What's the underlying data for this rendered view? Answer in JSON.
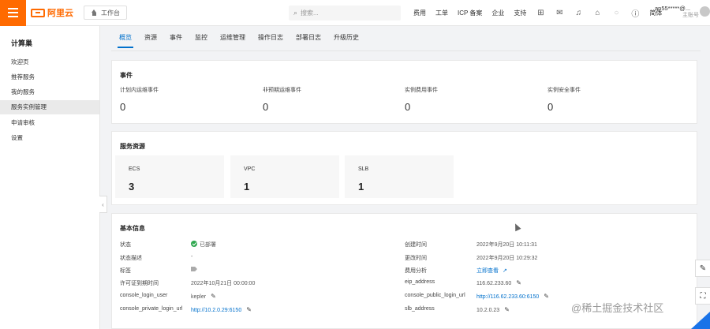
{
  "header": {
    "logo_text": "阿里云",
    "workbench_label": "工作台",
    "search_placeholder": "搜索...",
    "links": [
      "费用",
      "工单",
      "ICP 备案",
      "企业",
      "支持"
    ],
    "lang": "简体",
    "user_name": "ap55*****@...",
    "user_sub": "主账号"
  },
  "sidebar": {
    "title": "计算巢",
    "items": [
      "欢迎页",
      "推荐服务",
      "我的服务",
      "服务实例管理",
      "申请审核",
      "设置"
    ],
    "active_index": 3
  },
  "tabs": {
    "items": [
      "概览",
      "资源",
      "事件",
      "监控",
      "运维管理",
      "操作日志",
      "部署日志",
      "升级历史"
    ],
    "active_index": 0
  },
  "events": {
    "title": "事件",
    "items": [
      {
        "label": "计划内运维事件",
        "value": "0"
      },
      {
        "label": "非预期运维事件",
        "value": "0"
      },
      {
        "label": "实例费用事件",
        "value": "0"
      },
      {
        "label": "实例安全事件",
        "value": "0"
      }
    ]
  },
  "resources": {
    "title": "服务资源",
    "items": [
      {
        "label": "ECS",
        "value": "3"
      },
      {
        "label": "VPC",
        "value": "1"
      },
      {
        "label": "SLB",
        "value": "1"
      }
    ]
  },
  "basic_info": {
    "title": "基本信息",
    "left": [
      {
        "label": "状态",
        "value": "已部署"
      },
      {
        "label": "状态描述",
        "value": "-"
      },
      {
        "label": "标签",
        "value": ""
      },
      {
        "label": "许可证到期时间",
        "value": "2022年10月21日 00:00:00"
      },
      {
        "label": "console_login_user",
        "value": "kepler"
      },
      {
        "label": "console_private_login_url",
        "value": "http://10.2.0.29:6150"
      }
    ],
    "right": [
      {
        "label": "创建时间",
        "value": "2022年9月20日 10:11:31"
      },
      {
        "label": "更改时间",
        "value": "2022年9月20日 10:29:32"
      },
      {
        "label": "费用分析",
        "value": "立即查看"
      },
      {
        "label": "eip_address",
        "value": "116.62.233.60"
      },
      {
        "label": "console_public_login_url",
        "value": "http://116.62.233.60:6150"
      },
      {
        "label": "slb_address",
        "value": "10.2.0.23"
      }
    ]
  },
  "watermark": "@稀土掘金技术社区",
  "colors": {
    "brand": "#ff6a00",
    "link": "#0070cc",
    "success": "#2fa84f"
  }
}
